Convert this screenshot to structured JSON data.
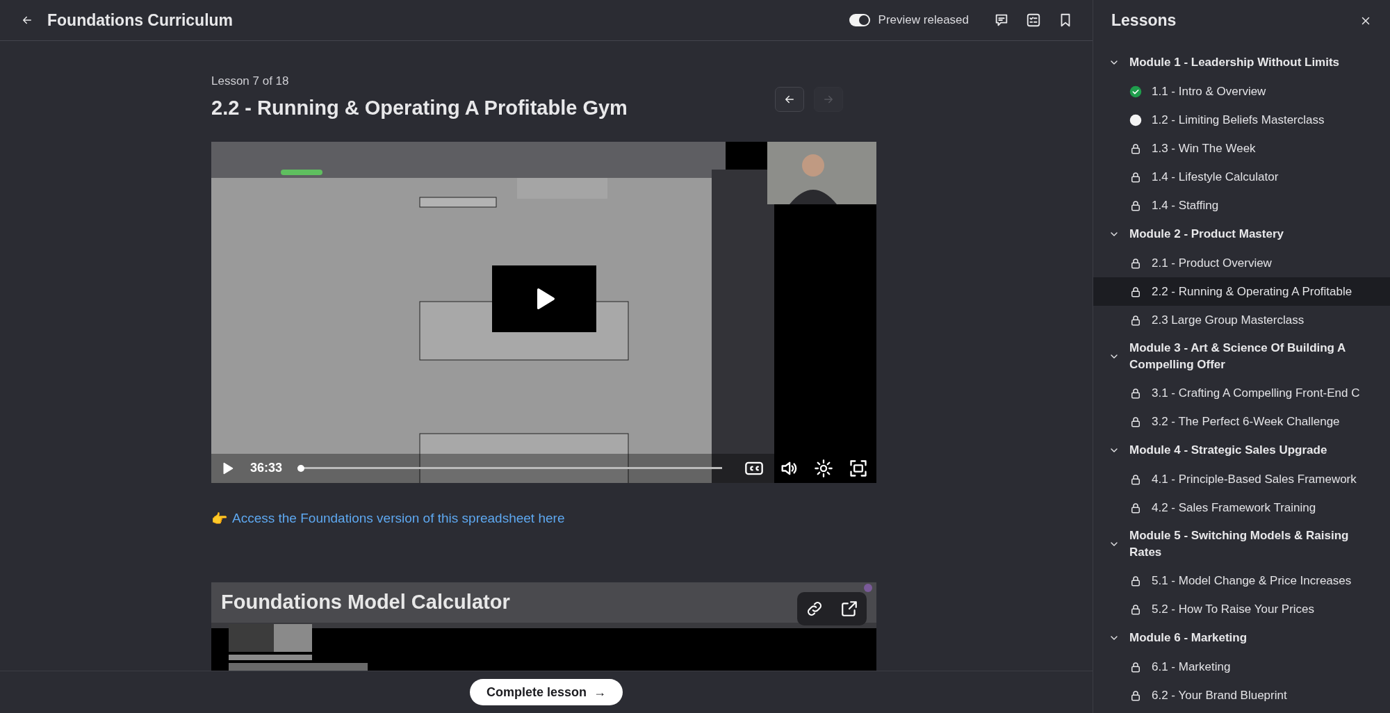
{
  "header": {
    "title": "Foundations Curriculum",
    "preview_toggle": {
      "label": "Preview released",
      "on": true
    }
  },
  "lesson": {
    "counter": "Lesson 7 of 18",
    "title": "2.2 - Running & Operating A Profitable Gym",
    "prev_disabled": false,
    "next_disabled": true
  },
  "video": {
    "kind": "picture",
    "time": "36:33",
    "level": 0.0
  },
  "link": {
    "emoji": "👉",
    "text": "Access the Foundations version of this spreadsheet here"
  },
  "embed": {
    "kind": "picture",
    "title": "Foundations Model Calculator"
  },
  "complete_button": {
    "label": "Complete lesson",
    "arrow": "→"
  },
  "sidebar": {
    "title": "Lessons",
    "modules": [
      {
        "title": "Module 1 - Leadership Without Limits",
        "expanded": true,
        "children": [
          {
            "label": "1.1 - Intro & Overview",
            "kind": "done",
            "selected": false
          },
          {
            "label": "1.2 - Limiting Beliefs Masterclass",
            "kind": "open",
            "selected": false
          },
          {
            "label": "1.3 - Win The Week",
            "kind": "locked",
            "selected": false
          },
          {
            "label": "1.4 - Lifestyle Calculator",
            "kind": "locked",
            "selected": false
          },
          {
            "label": "1.4 - Staffing",
            "kind": "locked",
            "selected": false
          }
        ]
      },
      {
        "title": "Module 2 - Product Mastery",
        "expanded": true,
        "children": [
          {
            "label": "2.1 - Product Overview",
            "kind": "locked",
            "selected": false
          },
          {
            "label": "2.2 - Running & Operating A Profitable",
            "kind": "locked",
            "selected": true
          },
          {
            "label": "2.3 Large Group Masterclass",
            "kind": "locked",
            "selected": false
          }
        ]
      },
      {
        "title": "Module 3 - Art & Science Of Building A Compelling Offer",
        "expanded": true,
        "children": [
          {
            "label": "3.1 - Crafting A Compelling Front-End C",
            "kind": "locked",
            "selected": false
          },
          {
            "label": "3.2 - The Perfect 6-Week Challenge",
            "kind": "locked",
            "selected": false
          }
        ]
      },
      {
        "title": "Module 4 - Strategic Sales Upgrade",
        "expanded": true,
        "children": [
          {
            "label": "4.1 - Principle-Based Sales Framework",
            "kind": "locked",
            "selected": false
          },
          {
            "label": "4.2 - Sales Framework Training",
            "kind": "locked",
            "selected": false
          }
        ]
      },
      {
        "title": "Module 5 - Switching Models & Raising Rates",
        "expanded": true,
        "children": [
          {
            "label": "5.1 - Model Change & Price Increases",
            "kind": "locked",
            "selected": false
          },
          {
            "label": "5.2 - How To Raise Your Prices",
            "kind": "locked",
            "selected": false
          }
        ]
      },
      {
        "title": "Module 6 - Marketing",
        "expanded": true,
        "children": [
          {
            "label": "6.1 - Marketing",
            "kind": "locked",
            "selected": false
          },
          {
            "label": "6.2 - Your Brand Blueprint",
            "kind": "locked",
            "selected": false
          }
        ]
      }
    ]
  }
}
